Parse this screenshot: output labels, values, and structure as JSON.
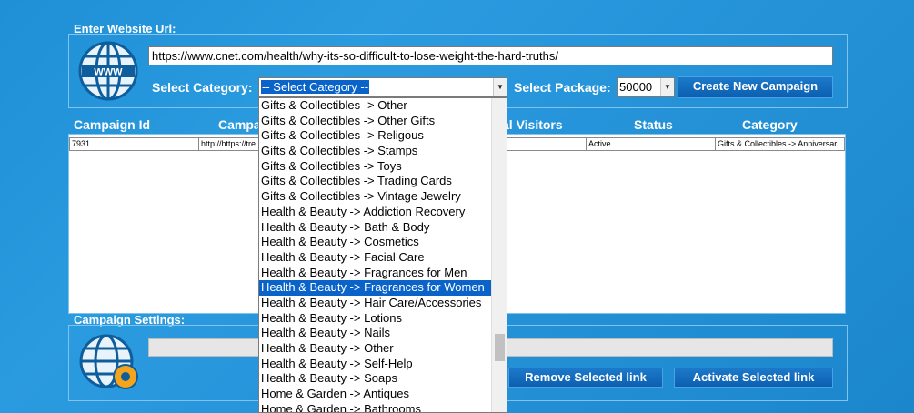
{
  "header": {
    "url_label": "Enter Website Url:"
  },
  "url_input": {
    "value": "https://www.cnet.com/health/why-its-so-difficult-to-lose-weight-the-hard-truths/"
  },
  "category": {
    "label": "Select Category:",
    "value": "-- Select Category --"
  },
  "package": {
    "label": "Select Package:",
    "value": "50000"
  },
  "buttons": {
    "create": "Create New Campaign",
    "remove": "Remove Selected link",
    "activate": "Activate Selected link"
  },
  "table": {
    "headers": [
      "Campaign Id",
      "Campa",
      "al Visitors",
      "Status",
      "Category"
    ],
    "rows": [
      {
        "id": "7931",
        "url": "http://https://tre",
        "status": "Active",
        "category": "Gifts & Collectibles -> Anniversar..."
      }
    ]
  },
  "settings": {
    "label": "Campaign Settings:"
  },
  "dropdown": {
    "selected_index": 12,
    "items": [
      "Gifts & Collectibles -> Other",
      "Gifts & Collectibles -> Other Gifts",
      "Gifts & Collectibles -> Religous",
      "Gifts & Collectibles -> Stamps",
      "Gifts & Collectibles -> Toys",
      "Gifts & Collectibles -> Trading Cards",
      "Gifts & Collectibles -> Vintage Jewelry",
      "Health & Beauty -> Addiction Recovery",
      "Health & Beauty -> Bath & Body",
      "Health & Beauty -> Cosmetics",
      "Health & Beauty -> Facial Care",
      "Health & Beauty -> Fragrances for Men",
      "Health & Beauty -> Fragrances for Women",
      "Health & Beauty -> Hair Care/Accessories",
      "Health & Beauty -> Lotions",
      "Health & Beauty -> Nails",
      "Health & Beauty -> Other",
      "Health & Beauty -> Self-Help",
      "Health & Beauty -> Soaps",
      "Home & Garden -> Antiques",
      "Home & Garden -> Bathrooms"
    ]
  }
}
